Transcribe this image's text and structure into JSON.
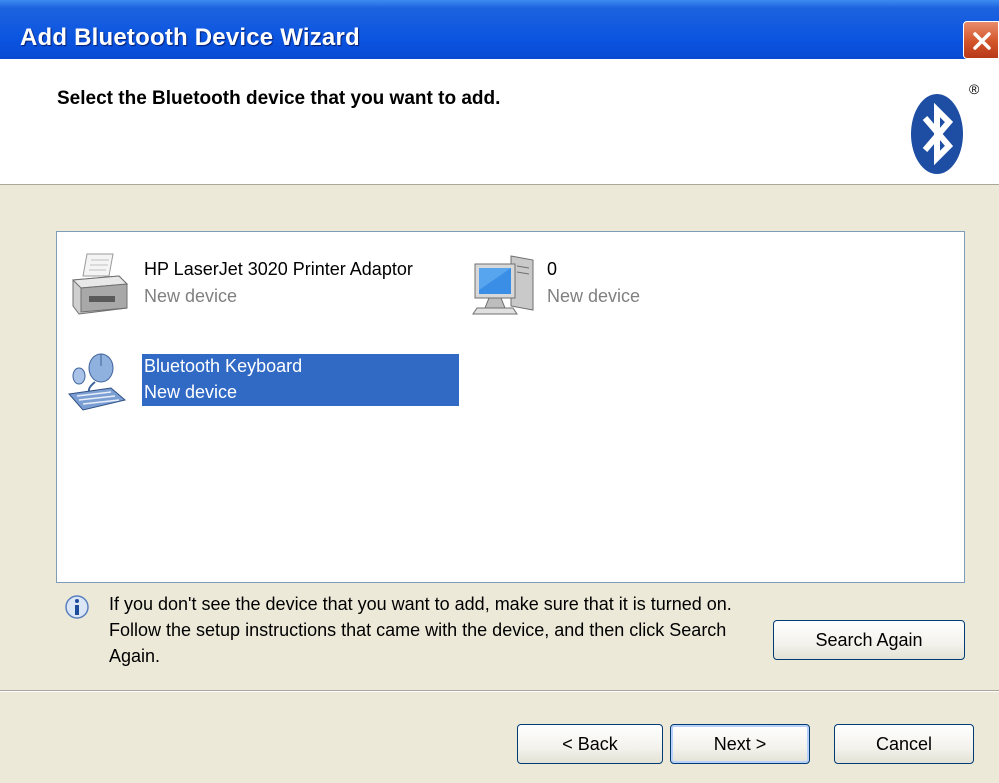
{
  "window": {
    "title": "Add Bluetooth Device Wizard"
  },
  "header": {
    "title": "Select the Bluetooth device that you want to add.",
    "logo_icon": "bluetooth-logo-icon",
    "registered_mark": "®"
  },
  "devices": [
    {
      "name": "HP LaserJet 3020 Printer Adaptor",
      "status": "New device",
      "icon": "printer-icon",
      "selected": false
    },
    {
      "name": "0",
      "status": "New device",
      "icon": "computer-icon",
      "selected": false
    },
    {
      "name": "Bluetooth Keyboard",
      "status": "New device",
      "icon": "keyboard-mouse-icon",
      "selected": true
    }
  ],
  "info": {
    "icon": "info-icon",
    "text": "If you don't see the device that you want to add, make sure that it is turned on. Follow the setup instructions that came with the device, and then click Search Again."
  },
  "buttons": {
    "search_again": "Search Again",
    "back": "< Back",
    "next": "Next >",
    "cancel": "Cancel"
  },
  "colors": {
    "titlebar": "#0a54e0",
    "selection": "#316ac5",
    "face": "#ece9d8",
    "bluetooth": "#1d4ea3"
  }
}
